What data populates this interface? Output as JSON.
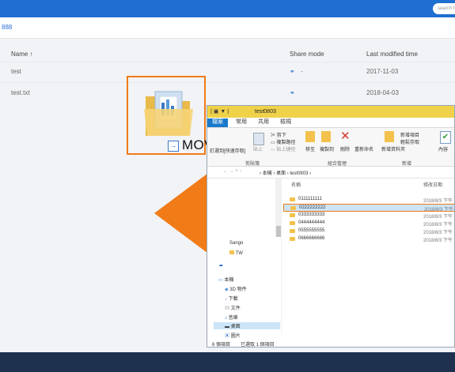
{
  "topbar": {
    "search_placeholder": "search f"
  },
  "breadcrumb": {
    "path": "888"
  },
  "table": {
    "columns": [
      "Name",
      "Share mode",
      "Last modified time"
    ],
    "sort_indicator": "↑",
    "rows": [
      {
        "name": "test",
        "share": "-",
        "modified": "2017-11-03"
      },
      {
        "name": "test.txt",
        "share": "",
        "modified": "2018-04-03"
      }
    ]
  },
  "overlay": {
    "label": "MOVE TO",
    "arrow_icon": "→",
    "arrow_color": "#f07b17"
  },
  "explorer": {
    "title": "test0803",
    "title_prefix": "| ▣ ▼ |",
    "tabs": [
      "檔案",
      "常用",
      "共用",
      "檢視"
    ],
    "ribbon": {
      "pin_label": "釘選到[快速存取]",
      "copy_label": "複製",
      "paste_label": "貼上",
      "cut_label": "剪下",
      "copy_path_label": "複製路徑",
      "paste_shortcut_label": "貼上捷徑",
      "move_to_label": "移至",
      "copy_to_label": "複製到",
      "delete_label": "刪除",
      "rename_label": "重新命名",
      "new_folder_label": "新增資料夾",
      "new_item_label": "新增項目",
      "easy_access_label": "輕鬆存取",
      "properties_label": "內容",
      "group_clipboard": "剪貼簿",
      "group_organize": "組合管理",
      "group_new": "新增"
    },
    "address": [
      "本機",
      "桌面",
      "test0803"
    ],
    "nav": [
      "Sango",
      "TW",
      "",
      "本機",
      "3D 物件",
      "下載",
      "文件",
      "音樂",
      "桌面",
      "圖片"
    ],
    "columns": [
      "名稱",
      "修改日期"
    ],
    "files": [
      {
        "name": "0111111111",
        "date": "2018/8/3 下午"
      },
      {
        "name": "0222222222",
        "date": "2018/8/3 下午"
      },
      {
        "name": "0333333333",
        "date": "2018/8/3 下午"
      },
      {
        "name": "0444444444",
        "date": "2018/8/3 下午"
      },
      {
        "name": "0555555555",
        "date": "2018/8/3 下午"
      },
      {
        "name": "0666666666",
        "date": "2018/8/3 下午"
      }
    ],
    "status_count": "6 個項目",
    "status_selected": "已選取 1 個項目"
  }
}
